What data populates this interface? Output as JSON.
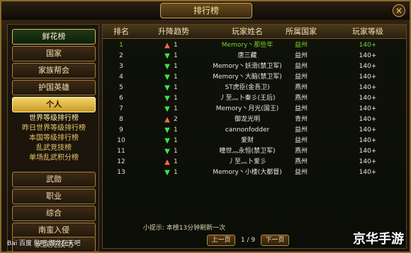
{
  "window": {
    "title": "排行榜",
    "close_label": "×"
  },
  "left_menu": {
    "top_button": "鲜花榜",
    "items": [
      {
        "label": "国家"
      },
      {
        "label": "家族帮会"
      },
      {
        "label": "护国英雄"
      },
      {
        "label": "个人",
        "active": true
      }
    ],
    "sub_items": [
      {
        "label": "世界等级排行榜",
        "selected": true
      },
      {
        "label": "昨日世界等级排行榜"
      },
      {
        "label": "本国等级排行榜"
      },
      {
        "label": "乱武竞技榜"
      },
      {
        "label": "单场乱武积分榜"
      }
    ],
    "bottom_items": [
      {
        "label": "武勋"
      },
      {
        "label": "职业"
      },
      {
        "label": "综合"
      },
      {
        "label": "南蛮入侵"
      },
      {
        "label": "家族竞技场"
      }
    ]
  },
  "table": {
    "headers": [
      "排名",
      "升降趋势",
      "玩家姓名",
      "所属国家",
      "玩家等级"
    ],
    "rows": [
      {
        "rank": "1",
        "trend": "up",
        "trend_num": "1",
        "name": "Memory丶那些年",
        "nation": "益州",
        "level": "140+"
      },
      {
        "rank": "2",
        "trend": "down",
        "trend_num": "1",
        "name": "唐三藏",
        "nation": "益州",
        "level": "140+"
      },
      {
        "rank": "3",
        "trend": "down",
        "trend_num": "1",
        "name": "Memory丶妖滑(禁卫军)",
        "nation": "益州",
        "level": "140+"
      },
      {
        "rank": "4",
        "trend": "down",
        "trend_num": "1",
        "name": "Memory丶大脑(禁卫军)",
        "nation": "益州",
        "level": "140+"
      },
      {
        "rank": "5",
        "trend": "down",
        "trend_num": "1",
        "name": "ST虎臣(金吾卫)",
        "nation": "燕州",
        "level": "140+"
      },
      {
        "rank": "6",
        "trend": "down",
        "trend_num": "1",
        "name": "丿至灬卜秦彡(王后)",
        "nation": "燕州",
        "level": "140+"
      },
      {
        "rank": "7",
        "trend": "down",
        "trend_num": "1",
        "name": "Memory丶月光(国王)",
        "nation": "益州",
        "level": "140+"
      },
      {
        "rank": "8",
        "trend": "up",
        "trend_num": "2",
        "name": "御龙光明",
        "nation": "青州",
        "level": "140+"
      },
      {
        "rank": "9",
        "trend": "down",
        "trend_num": "1",
        "name": "cannonfodder",
        "nation": "益州",
        "level": "140+"
      },
      {
        "rank": "10",
        "trend": "down",
        "trend_num": "1",
        "name": "爱财",
        "nation": "益州",
        "level": "140+"
      },
      {
        "rank": "11",
        "trend": "down",
        "trend_num": "1",
        "name": "瞳世灬永恒(禁卫军)",
        "nation": "燕州",
        "level": "140+"
      },
      {
        "rank": "12",
        "trend": "up",
        "trend_num": "1",
        "name": "丿至灬卜爱彡",
        "nation": "燕州",
        "level": "140+"
      },
      {
        "rank": "13",
        "trend": "down",
        "trend_num": "1",
        "name": "Memory丶小楼(大都督)",
        "nation": "益州",
        "level": "140+"
      }
    ]
  },
  "footer": {
    "tip": "小提示: 本榜13分钟刷新一次",
    "prev": "上一页",
    "page": "1 / 9",
    "next": "下一页"
  },
  "overlay": {
    "baidu": "Bai 百度 贴吧 御龙在天吧",
    "site": "京华手游"
  }
}
